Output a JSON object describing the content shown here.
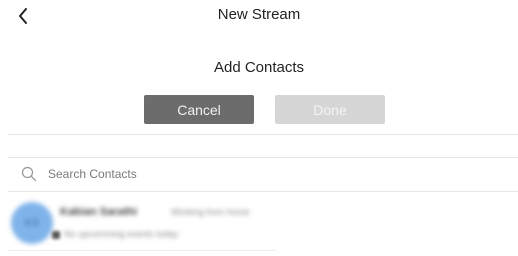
{
  "header": {
    "back_icon": "chevron-left-icon",
    "title": "New Stream"
  },
  "add_contacts": {
    "title": "Add Contacts",
    "cancel_label": "Cancel",
    "done_label": "Done",
    "done_enabled": false
  },
  "search": {
    "icon": "search-icon",
    "placeholder": "Search Contacts",
    "value": ""
  },
  "contacts": [
    {
      "initials": "KS",
      "name": "Kabian Sarathi",
      "status": "Working from home",
      "subtitle": "No upcomming events today"
    }
  ],
  "colors": {
    "cancel_bg": "#6c6c6c",
    "done_bg": "#d6d6d6",
    "avatar_bg": "#7fb4ea"
  }
}
